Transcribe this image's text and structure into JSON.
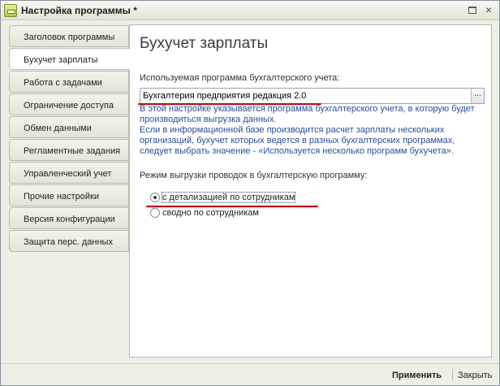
{
  "window": {
    "title": "Настройка программы *",
    "icons": {
      "app": "settings-app-icon",
      "maximize": "maximize-icon",
      "close": "close-icon"
    },
    "close_glyph": "×"
  },
  "tabs": [
    {
      "label": "Заголовок программы",
      "active": false
    },
    {
      "label": "Бухучет зарплаты",
      "active": true
    },
    {
      "label": "Работа с задачами",
      "active": false
    },
    {
      "label": "Ограничение доступа",
      "active": false
    },
    {
      "label": "Обмен данными",
      "active": false
    },
    {
      "label": "Регламентные задания",
      "active": false
    },
    {
      "label": "Управленческий учет",
      "active": false
    },
    {
      "label": "Прочие настройки",
      "active": false
    },
    {
      "label": "Версия конфигурации",
      "active": false
    },
    {
      "label": "Защита перс. данных",
      "active": false
    }
  ],
  "main": {
    "title": "Бухучет зарплаты",
    "program_label": "Используемая программа бухгалтерского учета:",
    "program_value": "Бухгалтерия предприятия редакция 2.0",
    "program_button": "...",
    "hint_1": "В этой настройке указывается программа бухгалтерского учета, в которую будет производиться выгрузка данных.",
    "hint_2": "Если в информационной базе производится расчет зарплаты нескольких организаций, бухучет которых ведется в разных бухгалтерских программах, следует выбрать значение - «Используется несколько программ бухучета».",
    "export_mode_label": "Режим выгрузки проводок в бухгалтерскую программу:",
    "export_modes": [
      {
        "label": "с детализацией по сотрудникам",
        "checked": true
      },
      {
        "label": "сводно по сотрудникам",
        "checked": false
      }
    ]
  },
  "footer": {
    "apply_label": "Применить",
    "close_label": "Закрыть"
  },
  "colors": {
    "hint_text": "#2b4b9b",
    "annotation_underline": "#b4121b",
    "window_background": "#eef0e6"
  }
}
